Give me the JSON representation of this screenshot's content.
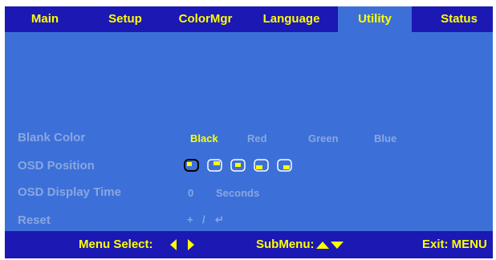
{
  "tabs": [
    {
      "label": "Main"
    },
    {
      "label": "Setup"
    },
    {
      "label": "ColorMgr"
    },
    {
      "label": "Language"
    },
    {
      "label": "Utility"
    },
    {
      "label": "Status"
    }
  ],
  "active_tab": "Utility",
  "rows": {
    "blank_color": {
      "label": "Blank Color",
      "options": [
        "Black",
        "Red",
        "Green",
        "Blue"
      ],
      "selected": "Black"
    },
    "osd_position": {
      "label": "OSD Position",
      "selected_index": 0
    },
    "osd_display_time": {
      "label": "OSD Display Time",
      "value": "0",
      "unit": "Seconds"
    },
    "reset": {
      "label": "Reset",
      "plus": "+",
      "slash": "/",
      "enter": "↵"
    }
  },
  "footer": {
    "menu_select": "Menu Select:",
    "submenu": "SubMenu:",
    "exit": "Exit: MENU"
  },
  "colors": {
    "panel": "#3c70d8",
    "bar": "#1b18b4",
    "highlight": "#ffff00",
    "dim_text": "#8aa6e0"
  }
}
